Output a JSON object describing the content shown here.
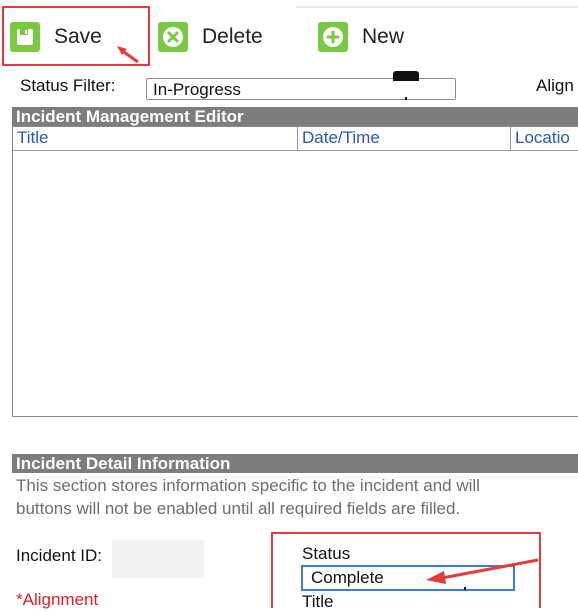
{
  "toolbar": {
    "save_label": "Save",
    "delete_label": "Delete",
    "new_label": "New"
  },
  "filter": {
    "label": "Status Filter:",
    "value": "In-Progress",
    "align_label": "Align"
  },
  "editor": {
    "header": "Incident Management Editor",
    "columns": [
      "Title",
      "Date/Time",
      "Locatio"
    ]
  },
  "detail": {
    "header": "Incident Detail Information",
    "desc_line1": "This section stores information specific to the incident and will",
    "desc_line2": "buttons will not be enabled until all required fields are filled.",
    "incident_id_label": "Incident ID:",
    "status_label": "Status",
    "status_value": "Complete",
    "title_label": "Title",
    "alignment_label": "*Alignment"
  },
  "colors": {
    "accent_green": "#7ac943",
    "highlight_red": "#e53b3b",
    "header_gray": "#7d7d7d",
    "link_blue": "#2a57b8",
    "focus_blue": "#3c7bd9"
  }
}
